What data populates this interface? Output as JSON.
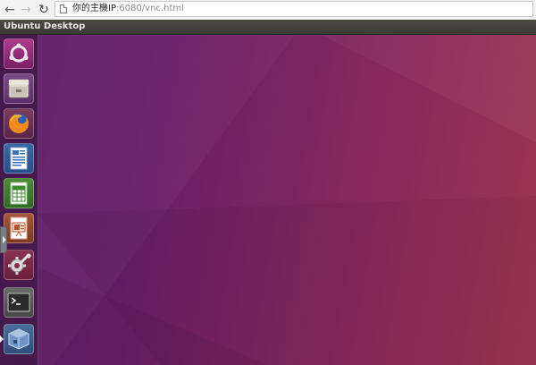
{
  "browser": {
    "back_icon": "arrow-left-icon",
    "forward_icon": "arrow-right-icon",
    "reload_icon": "reload-icon",
    "page_icon": "document-icon",
    "url_host": "你的主機IP",
    "url_path": ":6080/vnc.html"
  },
  "panel": {
    "title": "Ubuntu Desktop"
  },
  "desktop": {
    "colors": {
      "wallpaper_start": "#5e1f69",
      "wallpaper_end": "#9e3550",
      "panel": "#3c3b37"
    }
  },
  "launcher": {
    "items": [
      {
        "icon": "ubuntu-logo-icon"
      },
      {
        "icon": "files-cabinet-icon"
      },
      {
        "icon": "firefox-icon"
      },
      {
        "icon": "libreoffice-writer-icon"
      },
      {
        "icon": "libreoffice-calc-icon"
      },
      {
        "icon": "libreoffice-impress-icon"
      },
      {
        "icon": "system-settings-icon"
      },
      {
        "icon": "terminal-icon"
      },
      {
        "icon": "virtualbox-icon"
      }
    ]
  }
}
